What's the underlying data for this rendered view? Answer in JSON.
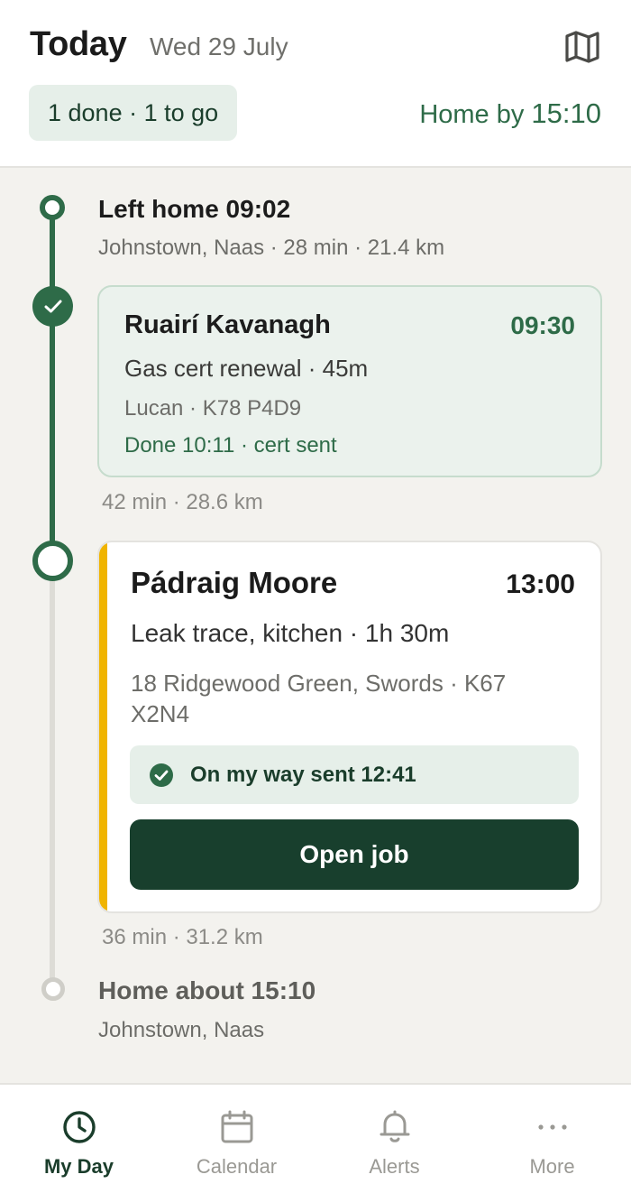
{
  "header": {
    "title": "Today",
    "date": "Wed 29 July",
    "progress": "1 done · 1 to go",
    "home_by_label": "Home by",
    "home_by_time": "15:10",
    "map_icon": "map-icon"
  },
  "timeline": {
    "start": {
      "title": "Left home 09:02",
      "subtitle": "Johnstown, Naas · 28 min · 21.4 km"
    },
    "done_job": {
      "name": "Ruairí Kavanagh",
      "time": "09:30",
      "job": "Gas cert renewal · 45m",
      "address": "Lucan · K78 P4D9",
      "status": "Done 10:11 · cert sent"
    },
    "leg_1": "42 min · 28.6 km",
    "current_job": {
      "name": "Pádraig Moore",
      "time": "13:00",
      "job": "Leak trace, kitchen · 1h 30m",
      "address": "18 Ridgewood Green, Swords · K67 X2N4",
      "sent_status": "On my way sent 12:41",
      "open_button": "Open job"
    },
    "leg_2": "36 min · 31.2 km",
    "end": {
      "title": "Home about 15:10",
      "subtitle": "Johnstown, Naas"
    }
  },
  "tabs": [
    {
      "label": "My Day",
      "icon": "clock-icon",
      "active": true
    },
    {
      "label": "Calendar",
      "icon": "calendar-icon",
      "active": false
    },
    {
      "label": "Alerts",
      "icon": "bell-icon",
      "active": false
    },
    {
      "label": "More",
      "icon": "more-icon",
      "active": false
    }
  ],
  "colors": {
    "brand_green": "#2e6b48",
    "dark_green": "#183f2d",
    "accent_amber": "#f0b400",
    "background": "#f3f2ee"
  }
}
